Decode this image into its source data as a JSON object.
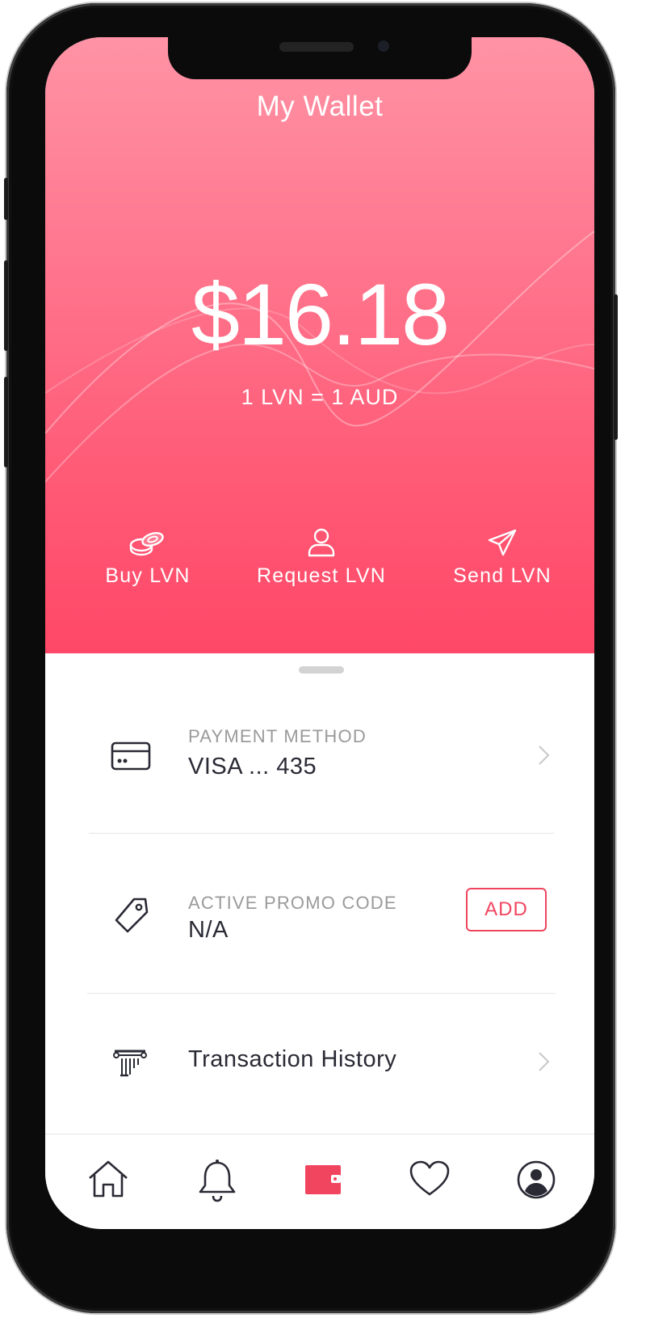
{
  "header": {
    "title": "My Wallet",
    "balance": "$16.18",
    "exchange_rate": "1 LVN = 1 AUD",
    "gradient_top": "#ff93a5",
    "gradient_bottom": "#ff4868"
  },
  "actions": [
    {
      "label": "Buy LVN",
      "icon": "coins-icon"
    },
    {
      "label": "Request LVN",
      "icon": "person-icon"
    },
    {
      "label": "Send LVN",
      "icon": "paper-plane-icon"
    }
  ],
  "details": {
    "payment": {
      "label": "PAYMENT METHOD",
      "value": "VISA ... 435",
      "icon": "credit-card-icon"
    },
    "promo": {
      "label": "ACTIVE PROMO CODE",
      "value": "N/A",
      "button": "ADD",
      "icon": "tag-icon"
    },
    "history": {
      "label": "Transaction History",
      "icon": "bank-pillar-icon"
    }
  },
  "tabbar": {
    "items": [
      "home-icon",
      "bell-icon",
      "wallet-icon",
      "heart-icon",
      "profile-icon"
    ],
    "active": "wallet-icon",
    "active_color": "#f1455f",
    "inactive_color": "#2a2a35"
  }
}
